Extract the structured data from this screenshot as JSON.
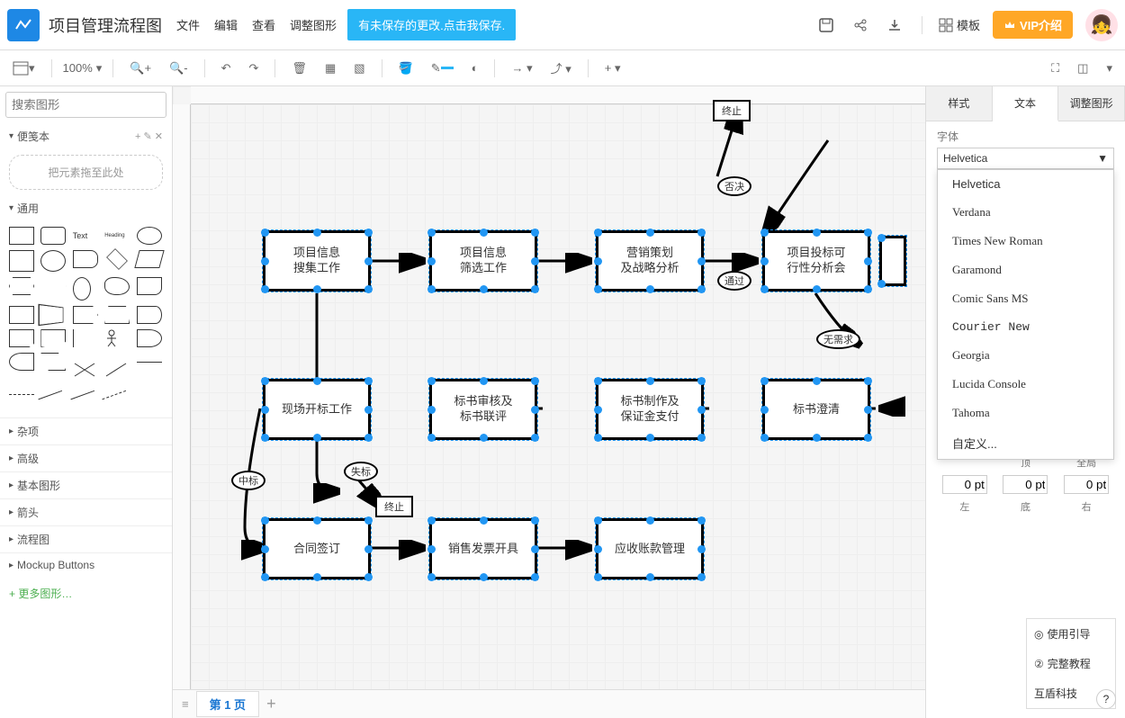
{
  "header": {
    "title": "项目管理流程图",
    "menu": [
      "文件",
      "编辑",
      "查看",
      "调整图形"
    ],
    "unsaved": "有未保存的更改.点击我保存.",
    "template": "模板",
    "vip": "VIP介绍"
  },
  "toolbar": {
    "zoom": "100%"
  },
  "sidebar": {
    "search_ph": "搜索图形",
    "scratchpad": "便笺本",
    "dropzone": "把元素拖至此处",
    "general": "通用",
    "heading_sample": "Heading",
    "text_sample": "Text",
    "cats": [
      "杂项",
      "高级",
      "基本图形",
      "箭头",
      "流程图",
      "Mockup Buttons"
    ],
    "more": "+ 更多图形…"
  },
  "nodes": {
    "n1": "项目信息\n搜集工作",
    "n2": "项目信息\n筛选工作",
    "n3": "营销策划\n及战略分析",
    "n4": "项目投标可\n行性分析会",
    "n5": "现场开标工作",
    "n6": "标书审核及\n标书联评",
    "n7": "标书制作及\n保证金支付",
    "n8": "标书澄清",
    "n9": "合同签订",
    "n10": "销售发票开具",
    "n11": "应收账款管理",
    "t1": "终止",
    "t2": "终止",
    "l_pass": "通过",
    "l_reject": "否决",
    "l_noneed": "无需求",
    "l_win": "中标",
    "l_lose": "失标"
  },
  "pages": {
    "p1": "第 1 页"
  },
  "rpanel": {
    "tabs": [
      "样式",
      "文本",
      "调整图形"
    ],
    "font_label": "字体",
    "font_value": "Helvetica",
    "fonts": [
      "Helvetica",
      "Verdana",
      "Times New Roman",
      "Garamond",
      "Comic Sans MS",
      "Courier New",
      "Georgia",
      "Lucida Console",
      "Tahoma",
      "自定义..."
    ],
    "spacing_top": "顶",
    "spacing_global": "全局",
    "spacing_left": "左",
    "spacing_bottom": "底",
    "spacing_right": "右",
    "sp_val": "0 pt",
    "help1": "使用引导",
    "help2": "完整教程",
    "help3": "互盾科技"
  }
}
